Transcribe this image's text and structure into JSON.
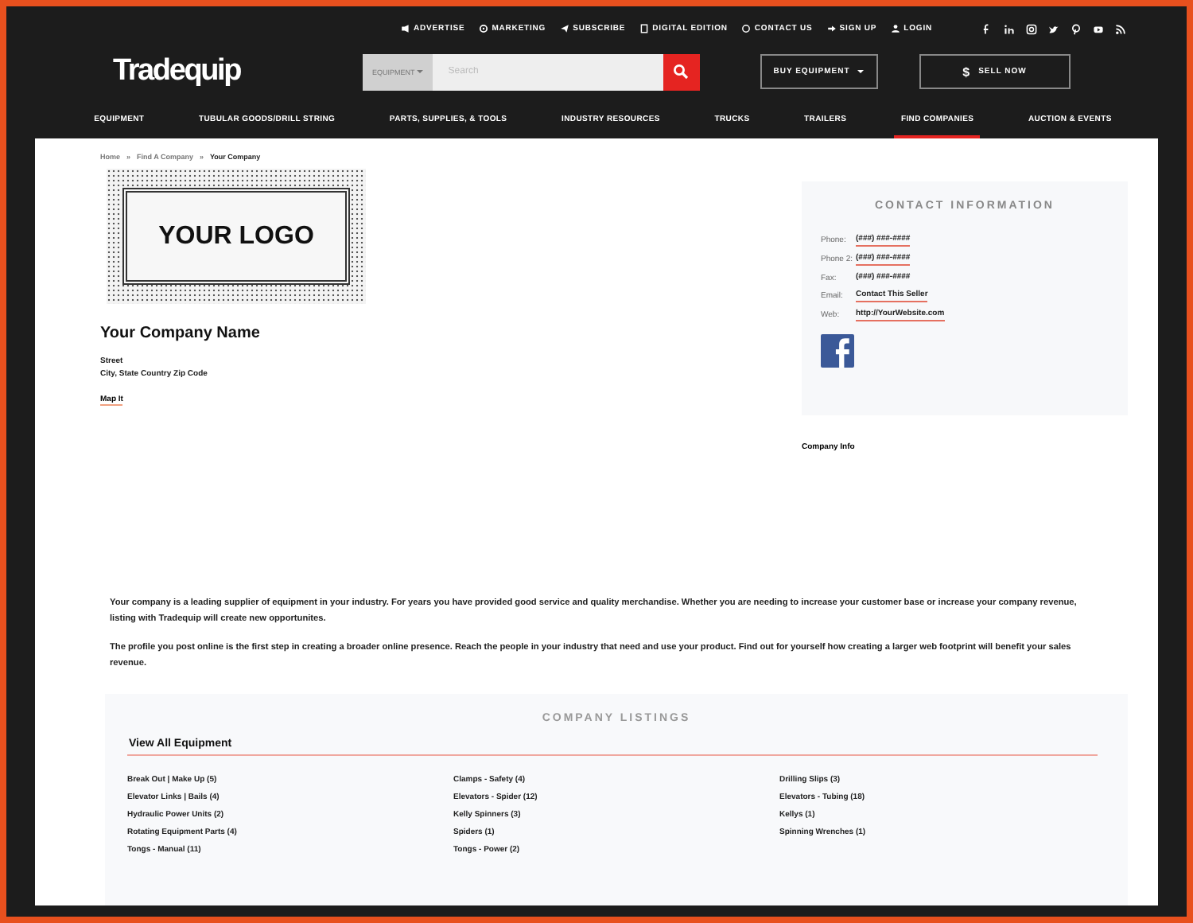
{
  "top_links": [
    {
      "label": "ADVERTISE"
    },
    {
      "label": "MARKETING"
    },
    {
      "label": "SUBSCRIBE"
    },
    {
      "label": "DIGITAL EDITION"
    },
    {
      "label": "CONTACT US"
    },
    {
      "label": "SIGN UP"
    },
    {
      "label": "LOGIN"
    }
  ],
  "logo": "Tradequip",
  "search": {
    "category": "EQUIPMENT",
    "placeholder": "Search"
  },
  "buy_button": "BUY EQUIPMENT",
  "sell_button": {
    "icon": "$",
    "label": "SELL NOW"
  },
  "nav": [
    {
      "label": "EQUIPMENT",
      "selected": false
    },
    {
      "label": "TUBULAR GOODS/DRILL STRING",
      "selected": false
    },
    {
      "label": "PARTS, SUPPLIES, & TOOLS",
      "selected": false
    },
    {
      "label": "INDUSTRY RESOURCES",
      "selected": false
    },
    {
      "label": "TRUCKS",
      "selected": false
    },
    {
      "label": "TRAILERS",
      "selected": false
    },
    {
      "label": "FIND COMPANIES",
      "selected": true
    },
    {
      "label": "AUCTION & EVENTS",
      "selected": false
    }
  ],
  "breadcrumb": {
    "separator": "»",
    "items": [
      "Home",
      "Find A Company",
      "Your Company"
    ]
  },
  "logo_placeholder": "YOUR LOGO",
  "company": {
    "name": "Your Company Name",
    "street": "Street",
    "city": "City, State Country Zip Code",
    "map_link": "Map It"
  },
  "contact": {
    "title": "CONTACT INFORMATION",
    "rows": [
      {
        "label": "Phone:",
        "value": "(###) ###-####",
        "link": true
      },
      {
        "label": "Phone 2:",
        "value": "(###) ###-####",
        "link": true
      },
      {
        "label": "Fax:",
        "value": "(###) ###-####",
        "link": false
      },
      {
        "label": "Email:",
        "value": "Contact This Seller",
        "link": true
      },
      {
        "label": "Web:",
        "value": "http://YourWebsite.com",
        "link": true
      }
    ]
  },
  "company_info_label": "Company Info",
  "paragraphs": [
    "Your company is a leading supplier of equipment in your industry. For years you have provided good service and quality merchandise. Whether you are needing to increase your customer base or increase your company revenue, listing with Tradequip will create new opportunites.",
    "The profile you post online is the first step in creating a broader online presence. Reach the people in your industry that need and use your product. Find out for yourself how creating a larger web footprint will benefit your sales revenue."
  ],
  "listings": {
    "title": "COMPANY LISTINGS",
    "heading": "View All Equipment",
    "items": [
      "Break Out | Make Up (5)",
      "Clamps - Safety (4)",
      "Drilling Slips (3)",
      "Elevator Links | Bails (4)",
      "Elevators - Spider (12)",
      "Elevators - Tubing (18)",
      "Hydraulic Power Units (2)",
      "Kelly Spinners (3)",
      "Kellys (1)",
      "Rotating Equipment Parts (4)",
      "Spiders (1)",
      "Spinning Wrenches (1)",
      "Tongs - Manual (11)",
      "Tongs - Power (2)"
    ]
  }
}
